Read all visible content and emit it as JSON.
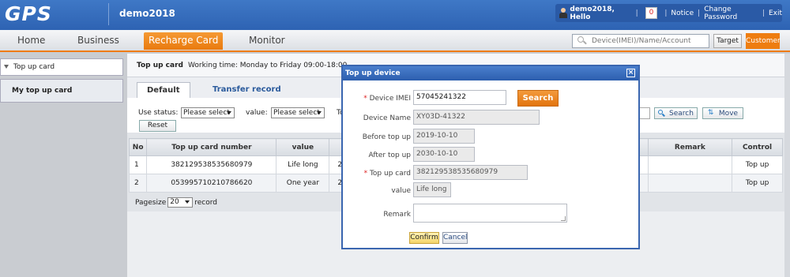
{
  "header": {
    "logo": "GPS",
    "account": "demo2018",
    "user_hello": "demo2018, Hello",
    "count": "0",
    "notice": "Notice",
    "change_password": "Change Password",
    "exit": "Exit",
    "separator": "|"
  },
  "nav": {
    "items": [
      "Home",
      "Business",
      "Recharge Card",
      "Monitor"
    ],
    "active": "Recharge Card",
    "search_placeholder": "Device(IMEI)/Name/Account",
    "target_label": "Target",
    "customer_label": "Customer"
  },
  "sidebar": {
    "top_label": "Top up card",
    "active_label": "My top up card"
  },
  "main": {
    "title": "Top up card",
    "working_time": "Working time: Monday to Friday 09:00-18:00",
    "tabs": [
      "Default",
      "Transfer record"
    ],
    "filters": {
      "use_status_label": "Use status:",
      "use_status_value": "Please select",
      "value_label": "value:",
      "value_value": "Please select",
      "partial_label": "To",
      "search_label": "Search",
      "move_label": "Move",
      "reset_label": "Reset"
    },
    "table": {
      "headers": [
        "No",
        "Top up card number",
        "value",
        "",
        "Remark",
        "Control"
      ],
      "rows": [
        {
          "no": "1",
          "card": "382129538535680979",
          "value": "Life long",
          "partial": "20",
          "remark": "",
          "control": "Top up"
        },
        {
          "no": "2",
          "card": "053995710210786620",
          "value": "One year",
          "partial": "20",
          "remark": "",
          "control": "Top up"
        }
      ]
    },
    "pager": {
      "prefix": "Pagesize",
      "size": "20",
      "suffix": "record"
    }
  },
  "dialog": {
    "title": "Top up device",
    "close": "×",
    "fields": {
      "imei_label": "Device IMEI",
      "imei_value": "57045241322",
      "search_label": "Search",
      "device_name_label": "Device Name",
      "device_name_value": "XY03D-41322",
      "before_label": "Before top up",
      "before_value": "2019-10-10",
      "after_label": "After top up",
      "after_value": "2030-10-10",
      "card_label": "Top up card",
      "card_value": "382129538535680979",
      "value_label": "value",
      "value_value": "Life long",
      "remark_label": "Remark",
      "remark_value": ""
    },
    "confirm_label": "Confirm",
    "cancel_label": "Cancel"
  },
  "colors": {
    "header_blue": "#2e63b3",
    "accent_orange": "#ee7d10",
    "required_red": "#dd2222"
  }
}
